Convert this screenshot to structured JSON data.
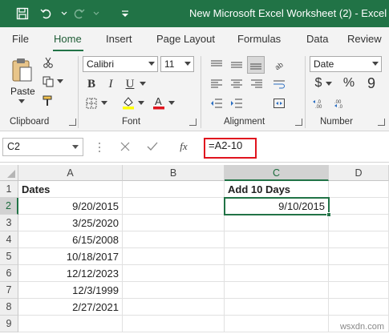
{
  "window": {
    "title": "New Microsoft Excel Worksheet (2)  -  Excel"
  },
  "ribbon_tabs": [
    "File",
    "Home",
    "Insert",
    "Page Layout",
    "Formulas",
    "Data",
    "Review"
  ],
  "clipboard": {
    "paste_label": "Paste",
    "group_label": "Clipboard"
  },
  "font": {
    "name": "Calibri",
    "size": "11",
    "group_label": "Font"
  },
  "alignment": {
    "group_label": "Alignment"
  },
  "number": {
    "format": "Date",
    "group_label": "Number",
    "currency": "$",
    "percent": "%",
    "comma": "9"
  },
  "formula_bar": {
    "name_box": "C2",
    "formula": "=A2-10",
    "fx": "fx"
  },
  "columns": [
    "A",
    "B",
    "C",
    "D"
  ],
  "rows": [
    "1",
    "2",
    "3",
    "4",
    "5",
    "6",
    "7",
    "8",
    "9"
  ],
  "cells": {
    "A1": "Dates",
    "A2": "9/20/2015",
    "A3": "3/25/2020",
    "A4": "6/15/2008",
    "A5": "10/18/2017",
    "A6": "12/12/2023",
    "A7": "12/3/1999",
    "A8": "2/27/2021",
    "C1": "Add 10 Days",
    "C2": "9/10/2015"
  },
  "watermark": "wsxdn.com",
  "colors": {
    "accent": "#217346",
    "highlight": "#e0141e"
  }
}
